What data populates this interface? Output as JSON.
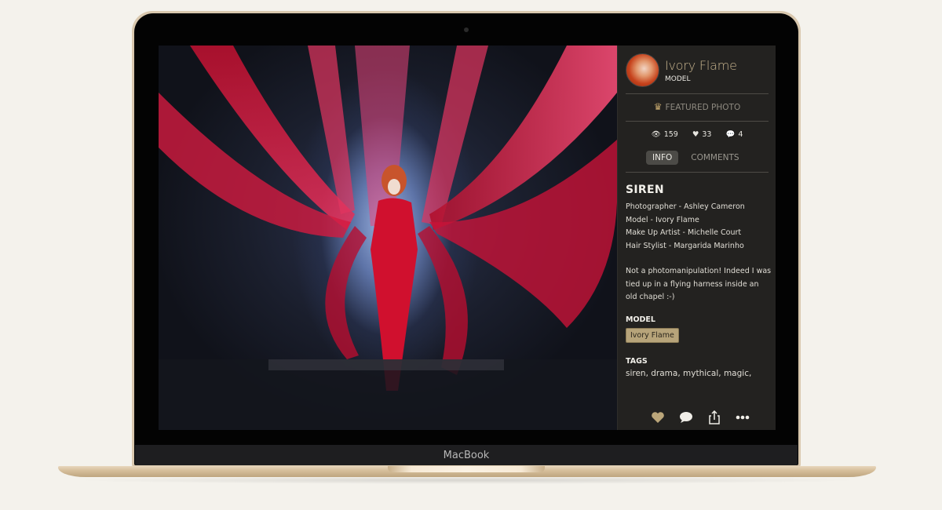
{
  "device": {
    "brand_label": "MacBook"
  },
  "photo": {
    "alt": "Model suspended among flowing red fabric in a dark chapel"
  },
  "profile": {
    "name": "Ivory Flame",
    "role": "MODEL"
  },
  "featured": {
    "icon": "crown-icon",
    "label": "FEATURED PHOTO"
  },
  "stats": {
    "views": "159",
    "likes": "33",
    "comments": "4"
  },
  "tabs": [
    {
      "label": "INFO",
      "active": true
    },
    {
      "label": "COMMENTS",
      "active": false
    }
  ],
  "info": {
    "title": "SIREN",
    "credits": [
      "Photographer - Ashley Cameron",
      "Model - Ivory Flame",
      "Make Up Artist - Michelle Court",
      "Hair Stylist - Margarida Marinho"
    ],
    "description": "Not a photomanipulation! Indeed I was tied up in a flying harness inside an old chapel :-)",
    "model_heading": "MODEL",
    "model_chip": "Ivory Flame",
    "tags_heading": "TAGS",
    "tags": "siren, drama, mythical, magic,"
  },
  "actions": [
    "like",
    "comment",
    "share",
    "more"
  ],
  "colors": {
    "accent": "#c2a56c",
    "panel": "#232220",
    "chip": "#b7a47a"
  }
}
